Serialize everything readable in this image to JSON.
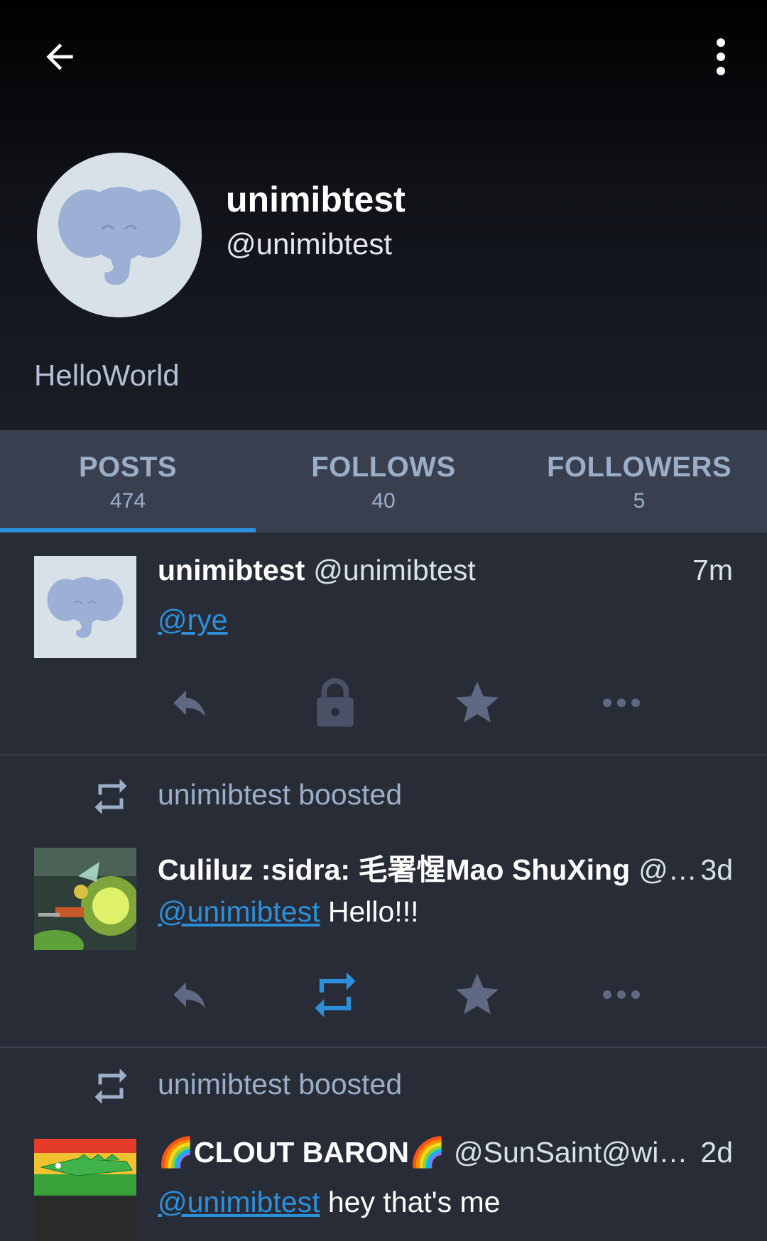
{
  "toolbar": {
    "back_icon": "arrow-left-icon",
    "menu_icon": "more-vertical-icon"
  },
  "profile": {
    "display_name": "unimibtest",
    "account": "@unimibtest",
    "bio": "HelloWorld"
  },
  "tabs": [
    {
      "label": "POSTS",
      "count": "474",
      "active": true
    },
    {
      "label": "FOLLOWS",
      "count": "40",
      "active": false
    },
    {
      "label": "FOLLOWERS",
      "count": "5",
      "active": false
    }
  ],
  "posts": [
    {
      "name": "unimibtest",
      "acct": "@unimibtest",
      "time": "7m",
      "mention": "@rye",
      "text": ""
    },
    {
      "boost_text": "unimibtest boosted",
      "name": "Culiluz :sidra: 毛署惺Mao ShuXing",
      "acct": "@X…",
      "time": "3d",
      "mention": "@unimibtest",
      "text": " Hello!!!"
    },
    {
      "boost_text": "unimibtest boosted",
      "name": "🌈CLOUT BARON🌈",
      "acct": "@SunSaint@wit…",
      "time": "2d",
      "mention": "@unimibtest",
      "text": " hey that's me"
    }
  ],
  "colors": {
    "accent": "#2b90d9",
    "icon_muted": "#606984",
    "background": "#282c37"
  }
}
